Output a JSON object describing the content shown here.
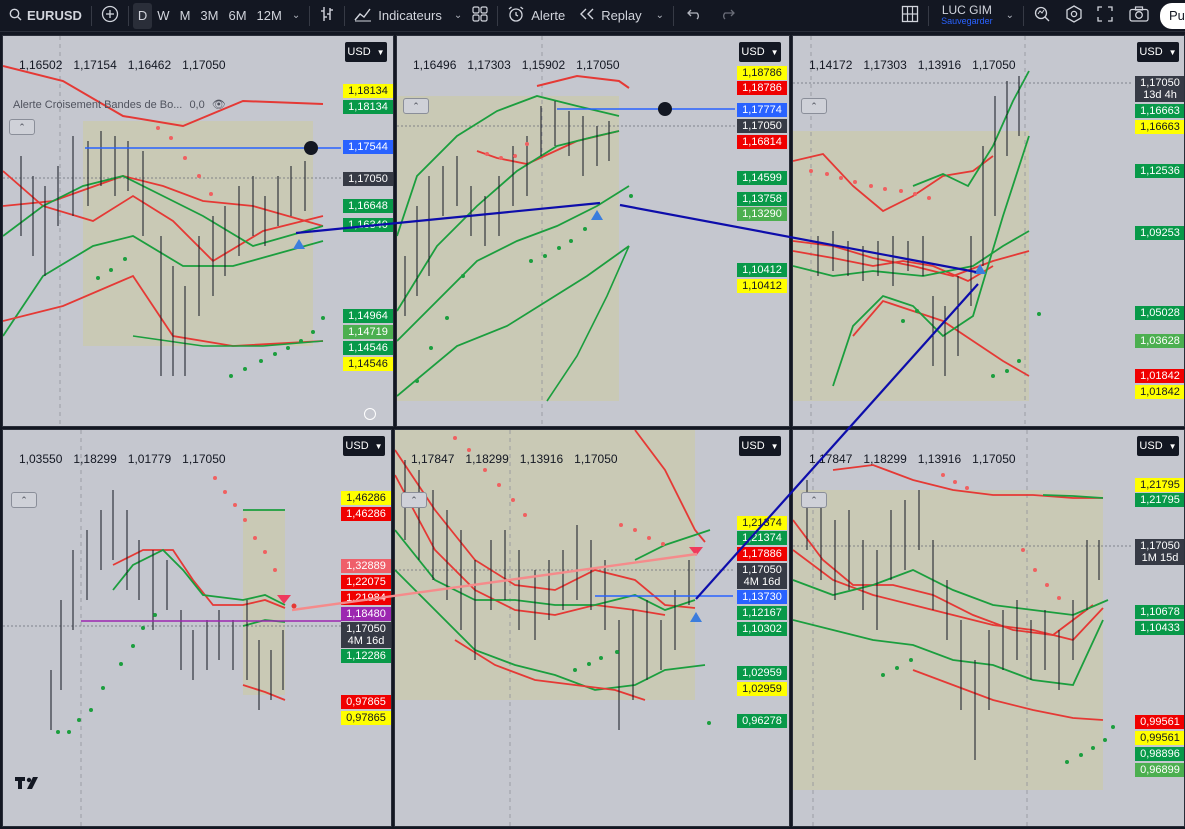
{
  "toolbar": {
    "symbol": "EURUSD",
    "timeframes": [
      "D",
      "W",
      "M",
      "3M",
      "6M",
      "12M"
    ],
    "selected_timeframe": "D",
    "indicators_label": "Indicateurs",
    "alert_label": "Alerte",
    "replay_label": "Replay",
    "layout_name": "LUC GIM",
    "layout_status": "Sauvegarder",
    "publish_label": "Pu"
  },
  "panes": [
    {
      "currency": "USD",
      "ohlc": [
        "1,16502",
        "1,17154",
        "1,16462",
        "1,17050"
      ],
      "alert_name": "Alerte Croisement Bandes de Bo...",
      "alert_value": "0,0",
      "tags": [
        {
          "text": "1,18134",
          "style": "y"
        },
        {
          "text": "1,18134",
          "style": "g"
        },
        {
          "text": "1,17544",
          "style": "b"
        },
        {
          "text": "1,17050",
          "style": "bk"
        },
        {
          "text": "1,16648",
          "style": "g"
        },
        {
          "text": "1,16340",
          "style": "g"
        },
        {
          "text": "1,14964",
          "style": "g"
        },
        {
          "text": "1,14719",
          "style": "lg"
        },
        {
          "text": "1,14546",
          "style": "g"
        },
        {
          "text": "1,14546",
          "style": "y"
        }
      ]
    },
    {
      "currency": "USD",
      "ohlc": [
        "1,16496",
        "1,17303",
        "1,15902",
        "1,17050"
      ],
      "tags": [
        {
          "text": "1,18786",
          "style": "y"
        },
        {
          "text": "1,18786",
          "style": "r"
        },
        {
          "text": "1,17774",
          "style": "b"
        },
        {
          "text": "1,17050",
          "style": "bk"
        },
        {
          "text": "1,16814",
          "style": "r"
        },
        {
          "text": "1,14599",
          "style": "g"
        },
        {
          "text": "1,13758",
          "style": "g"
        },
        {
          "text": "1,13290",
          "style": "lg"
        },
        {
          "text": "1,10412",
          "style": "g"
        },
        {
          "text": "1,10412",
          "style": "y"
        }
      ]
    },
    {
      "currency": "USD",
      "ohlc": [
        "1,14172",
        "1,17303",
        "1,13916",
        "1,17050"
      ],
      "tags": [
        {
          "text": "1,17050",
          "sub": "13d 4h",
          "style": "bk"
        },
        {
          "text": "1,16663",
          "style": "g"
        },
        {
          "text": "1,16663",
          "style": "y"
        },
        {
          "text": "1,12536",
          "style": "g"
        },
        {
          "text": "1,09253",
          "style": "g"
        },
        {
          "text": "1,05028",
          "style": "g"
        },
        {
          "text": "1,03628",
          "style": "lg"
        },
        {
          "text": "1,01842",
          "style": "r"
        },
        {
          "text": "1,01842",
          "style": "y"
        }
      ]
    },
    {
      "currency": "USD",
      "ohlc": [
        "1,03550",
        "1,18299",
        "1,01779",
        "1,17050"
      ],
      "tags": [
        {
          "text": "1,46286",
          "style": "y"
        },
        {
          "text": "1,46286",
          "style": "r"
        },
        {
          "text": "1,32889",
          "style": "p"
        },
        {
          "text": "1,22075",
          "style": "r"
        },
        {
          "text": "1,21984",
          "style": "r"
        },
        {
          "text": "1,18480",
          "style": "pu"
        },
        {
          "text": "1,17050",
          "sub": "4M 16d",
          "style": "bk"
        },
        {
          "text": "1,12286",
          "style": "g"
        },
        {
          "text": "0,97865",
          "style": "r"
        },
        {
          "text": "0,97865",
          "style": "y"
        }
      ]
    },
    {
      "currency": "USD",
      "ohlc": [
        "1,17847",
        "1,18299",
        "1,13916",
        "1,17050"
      ],
      "tags": [
        {
          "text": "1,21374",
          "style": "y"
        },
        {
          "text": "1,21374",
          "style": "g"
        },
        {
          "text": "1,17886",
          "style": "r"
        },
        {
          "text": "1,17050",
          "sub": "4M 16d",
          "style": "bk"
        },
        {
          "text": "1,13730",
          "style": "b"
        },
        {
          "text": "1,12167",
          "style": "g"
        },
        {
          "text": "1,10302",
          "style": "g"
        },
        {
          "text": "1,02959",
          "style": "g"
        },
        {
          "text": "1,02959",
          "style": "y"
        },
        {
          "text": "0,96278",
          "style": "g"
        }
      ]
    },
    {
      "currency": "USD",
      "ohlc": [
        "1,17847",
        "1,18299",
        "1,13916",
        "1,17050"
      ],
      "tags": [
        {
          "text": "1,21795",
          "style": "y"
        },
        {
          "text": "1,21795",
          "style": "g"
        },
        {
          "text": "1,17050",
          "sub": "1M 15d",
          "style": "bk"
        },
        {
          "text": "1,10678",
          "style": "g"
        },
        {
          "text": "1,10433",
          "style": "g"
        },
        {
          "text": "0,99561",
          "style": "r"
        },
        {
          "text": "0,99561",
          "style": "y"
        },
        {
          "text": "0,98896",
          "style": "g"
        },
        {
          "text": "0,96899",
          "style": "lg"
        }
      ]
    }
  ],
  "colors": {
    "background": "#c5c7cf",
    "band_fill": "#c9c9b5",
    "upper_band": "#e53935",
    "lower_band": "#1b9e3e",
    "trendline_dark": "#0d0dab",
    "trendline_pink": "#f58b8b",
    "horizontal_blue": "#2962ff",
    "horizontal_purple": "#9c27b0"
  }
}
